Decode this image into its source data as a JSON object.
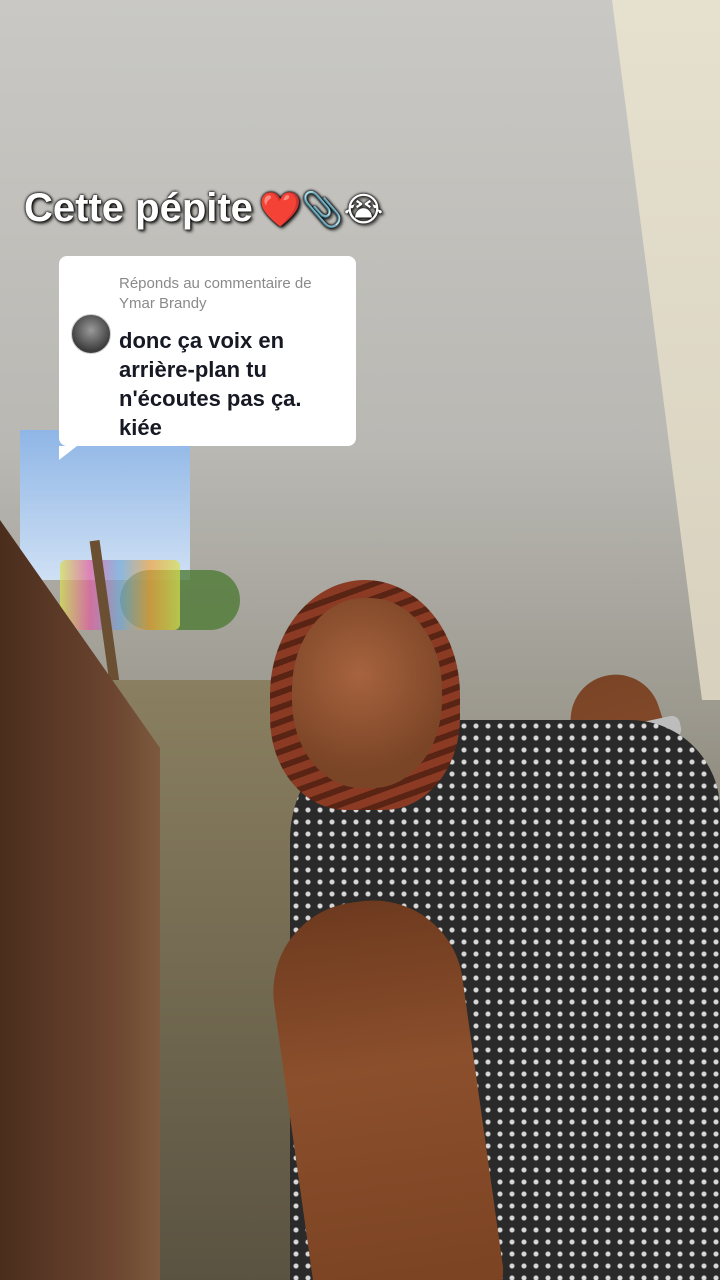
{
  "overlay": {
    "title_text": "Cette pépite",
    "title_emojis": "❤️📎😭"
  },
  "reply_bubble": {
    "reply_to_label": "Réponds au commentaire de Ymar Brandy",
    "comment_text": "donc ça voix en arrière-plan tu n'écoutes pas ça. kiée",
    "avatar_icon": "user-avatar"
  },
  "colors": {
    "bubble_bg": "#ffffff",
    "comment_text": "#161823",
    "reply_label": "#8a8a8a",
    "title_text": "#ffffff"
  }
}
